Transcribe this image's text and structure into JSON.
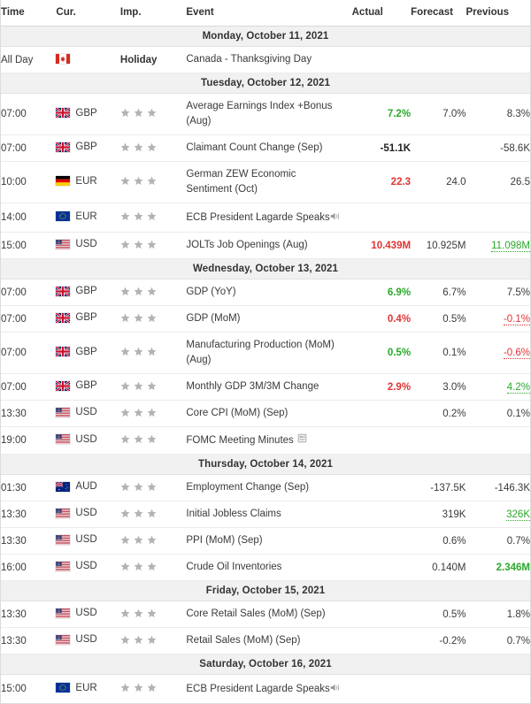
{
  "table": {
    "columns": [
      {
        "key": "time",
        "label": "Time"
      },
      {
        "key": "currency",
        "label": "Cur."
      },
      {
        "key": "importance",
        "label": "Imp."
      },
      {
        "key": "event",
        "label": "Event"
      },
      {
        "key": "actual",
        "label": "Actual"
      },
      {
        "key": "forecast",
        "label": "Forecast"
      },
      {
        "key": "previous",
        "label": "Previous"
      }
    ]
  },
  "colors": {
    "up": "#2aa82a",
    "down": "#e03434",
    "neutral": "#3a3a3a",
    "day_header_bg": "#f1f1f1",
    "star": "#b3b3b3",
    "border": "#ececec"
  },
  "days": [
    {
      "date_label": "Monday, October 11, 2021",
      "rows": [
        {
          "time": "All Day",
          "flag": "ca-flag-icon",
          "currency": "",
          "importance_label": "Holiday",
          "stars": 0,
          "event": "Canada - Thanksgiving Day",
          "event_line2": "",
          "icon": "",
          "actual": "",
          "actual_state": "none",
          "forecast": "",
          "previous": "",
          "previous_state": "none"
        }
      ]
    },
    {
      "date_label": "Tuesday, October 12, 2021",
      "rows": [
        {
          "time": "07:00",
          "flag": "gb-flag-icon",
          "currency": "GBP",
          "importance_label": "",
          "stars": 3,
          "event": "Average Earnings Index +Bonus",
          "event_line2": "(Aug)",
          "icon": "",
          "actual": "7.2%",
          "actual_state": "up",
          "forecast": "7.0%",
          "previous": "8.3%",
          "previous_state": "none"
        },
        {
          "time": "07:00",
          "flag": "gb-flag-icon",
          "currency": "GBP",
          "importance_label": "",
          "stars": 3,
          "event": "Claimant Count Change (Sep)",
          "event_line2": "",
          "icon": "",
          "actual": "-51.1K",
          "actual_state": "bold",
          "forecast": "",
          "previous": "-58.6K",
          "previous_state": "none"
        },
        {
          "time": "10:00",
          "flag": "de-flag-icon",
          "currency": "EUR",
          "importance_label": "",
          "stars": 3,
          "event": "German ZEW Economic",
          "event_line2": "Sentiment (Oct)",
          "icon": "",
          "actual": "22.3",
          "actual_state": "down",
          "forecast": "24.0",
          "previous": "26.5",
          "previous_state": "none"
        },
        {
          "time": "14:00",
          "flag": "eu-flag-icon",
          "currency": "EUR",
          "importance_label": "",
          "stars": 3,
          "event": "ECB President Lagarde Speaks",
          "event_line2": "",
          "icon": "speaker-icon",
          "actual": "",
          "actual_state": "none",
          "forecast": "",
          "previous": "",
          "previous_state": "none"
        },
        {
          "time": "15:00",
          "flag": "us-flag-icon",
          "currency": "USD",
          "importance_label": "",
          "stars": 3,
          "event": "JOLTs Job Openings (Aug)",
          "event_line2": "",
          "icon": "",
          "actual": "10.439M",
          "actual_state": "down",
          "forecast": "10.925M",
          "previous": "11.098M",
          "previous_state": "up-underline"
        }
      ]
    },
    {
      "date_label": "Wednesday, October 13, 2021",
      "rows": [
        {
          "time": "07:00",
          "flag": "gb-flag-icon",
          "currency": "GBP",
          "importance_label": "",
          "stars": 3,
          "event": "GDP (YoY)",
          "event_line2": "",
          "icon": "",
          "actual": "6.9%",
          "actual_state": "up",
          "forecast": "6.7%",
          "previous": "7.5%",
          "previous_state": "none"
        },
        {
          "time": "07:00",
          "flag": "gb-flag-icon",
          "currency": "GBP",
          "importance_label": "",
          "stars": 3,
          "event": "GDP (MoM)",
          "event_line2": "",
          "icon": "",
          "actual": "0.4%",
          "actual_state": "down",
          "forecast": "0.5%",
          "previous": "-0.1%",
          "previous_state": "down-underline"
        },
        {
          "time": "07:00",
          "flag": "gb-flag-icon",
          "currency": "GBP",
          "importance_label": "",
          "stars": 3,
          "event": "Manufacturing Production (MoM)",
          "event_line2": "(Aug)",
          "icon": "",
          "actual": "0.5%",
          "actual_state": "up",
          "forecast": "0.1%",
          "previous": "-0.6%",
          "previous_state": "down-underline"
        },
        {
          "time": "07:00",
          "flag": "gb-flag-icon",
          "currency": "GBP",
          "importance_label": "",
          "stars": 3,
          "event": "Monthly GDP 3M/3M Change",
          "event_line2": "",
          "icon": "",
          "actual": "2.9%",
          "actual_state": "down",
          "forecast": "3.0%",
          "previous": "4.2%",
          "previous_state": "up-underline"
        },
        {
          "time": "13:30",
          "flag": "us-flag-icon",
          "currency": "USD",
          "importance_label": "",
          "stars": 3,
          "event": "Core CPI (MoM) (Sep)",
          "event_line2": "",
          "icon": "",
          "actual": "",
          "actual_state": "none",
          "forecast": "0.2%",
          "previous": "0.1%",
          "previous_state": "none"
        },
        {
          "time": "19:00",
          "flag": "us-flag-icon",
          "currency": "USD",
          "importance_label": "",
          "stars": 3,
          "event": "FOMC Meeting Minutes",
          "event_line2": "",
          "icon": "document-icon",
          "actual": "",
          "actual_state": "none",
          "forecast": "",
          "previous": "",
          "previous_state": "none"
        }
      ]
    },
    {
      "date_label": "Thursday, October 14, 2021",
      "rows": [
        {
          "time": "01:30",
          "flag": "au-flag-icon",
          "currency": "AUD",
          "importance_label": "",
          "stars": 3,
          "event": "Employment Change (Sep)",
          "event_line2": "",
          "icon": "",
          "actual": "",
          "actual_state": "none",
          "forecast": "-137.5K",
          "previous": "-146.3K",
          "previous_state": "none"
        },
        {
          "time": "13:30",
          "flag": "us-flag-icon",
          "currency": "USD",
          "importance_label": "",
          "stars": 3,
          "event": "Initial Jobless Claims",
          "event_line2": "",
          "icon": "",
          "actual": "",
          "actual_state": "none",
          "forecast": "319K",
          "previous": "326K",
          "previous_state": "up-underline"
        },
        {
          "time": "13:30",
          "flag": "us-flag-icon",
          "currency": "USD",
          "importance_label": "",
          "stars": 3,
          "event": "PPI (MoM) (Sep)",
          "event_line2": "",
          "icon": "",
          "actual": "",
          "actual_state": "none",
          "forecast": "0.6%",
          "previous": "0.7%",
          "previous_state": "none"
        },
        {
          "time": "16:00",
          "flag": "us-flag-icon",
          "currency": "USD",
          "importance_label": "",
          "stars": 3,
          "event": "Crude Oil Inventories",
          "event_line2": "",
          "icon": "",
          "actual": "",
          "actual_state": "none",
          "forecast": "0.140M",
          "previous": "2.346M",
          "previous_state": "up"
        }
      ]
    },
    {
      "date_label": "Friday, October 15, 2021",
      "rows": [
        {
          "time": "13:30",
          "flag": "us-flag-icon",
          "currency": "USD",
          "importance_label": "",
          "stars": 3,
          "event": "Core Retail Sales (MoM) (Sep)",
          "event_line2": "",
          "icon": "",
          "actual": "",
          "actual_state": "none",
          "forecast": "0.5%",
          "previous": "1.8%",
          "previous_state": "none"
        },
        {
          "time": "13:30",
          "flag": "us-flag-icon",
          "currency": "USD",
          "importance_label": "",
          "stars": 3,
          "event": "Retail Sales (MoM) (Sep)",
          "event_line2": "",
          "icon": "",
          "actual": "",
          "actual_state": "none",
          "forecast": "-0.2%",
          "previous": "0.7%",
          "previous_state": "none"
        }
      ]
    },
    {
      "date_label": "Saturday, October 16, 2021",
      "rows": [
        {
          "time": "15:00",
          "flag": "eu-flag-icon",
          "currency": "EUR",
          "importance_label": "",
          "stars": 3,
          "event": "ECB President Lagarde Speaks",
          "event_line2": "",
          "icon": "speaker-icon",
          "actual": "",
          "actual_state": "none",
          "forecast": "",
          "previous": "",
          "previous_state": "none"
        }
      ]
    }
  ]
}
